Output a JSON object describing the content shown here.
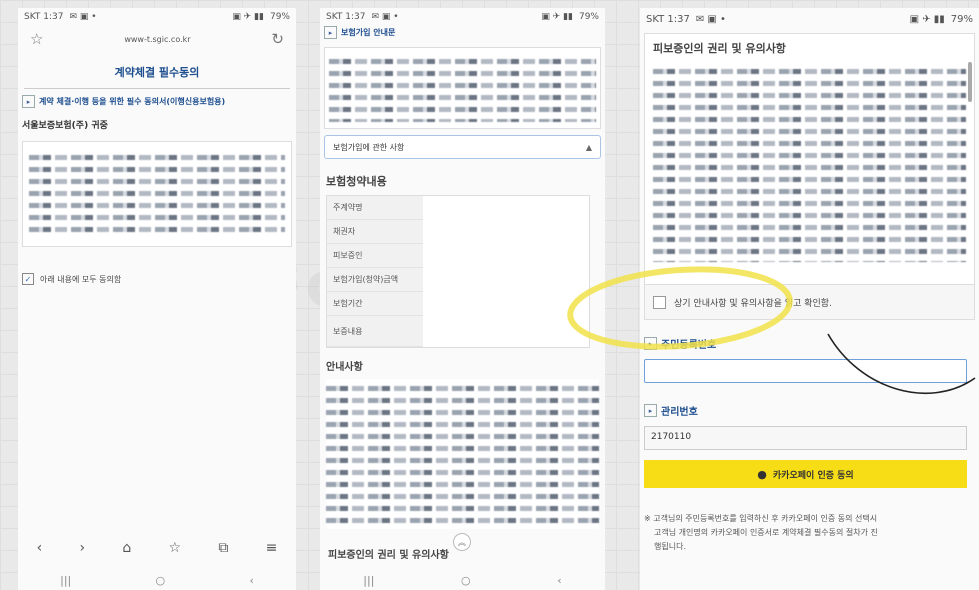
{
  "colors": {
    "accent": "#1d4e8f",
    "yellow_button": "#f7dd16",
    "highlight": "#f2e24a",
    "dark_arrow": "#222"
  },
  "watermark": "Kid Found",
  "left": {
    "status_time": "SKT 1:37",
    "status_right": "79%",
    "url": "www-t.sgic.co.kr",
    "page_title": "계약체결 필수동의",
    "section_header": "계약 체결·이행 등을 위한 필수 동의서(이행신용보험용)",
    "company": "서울보증보험(주) 귀중",
    "agree_all": "아래 내용에 모두 동의함"
  },
  "middle": {
    "status_time": "SKT 1:37",
    "status_right": "79%",
    "section_header": "보험가입 안내문",
    "dropdown_label": "보험가입에 관한 사항",
    "contract_title": "보험청약내용",
    "table_rows": [
      "주계약명",
      "채권자",
      "피보증인",
      "보험가입(청약)금액",
      "보험기간",
      "보증내용"
    ],
    "notice_title": "안내사항",
    "bottom_title": "피보증인의 권리 및 유의사항"
  },
  "right": {
    "status_time": "SKT 1:37",
    "status_right": "79%",
    "title": "피보증인의 권리 및 유의사항",
    "confirm_label": "상기 안내사항 및 유의사항을 읽고 확인함.",
    "rrn_header": "주민등록번호",
    "rrn_value": "",
    "mgmt_header": "관리번호",
    "mgmt_value": "2170110",
    "kakao_button": "카카오페이 인증 동의",
    "footnote_line1": "※ 고객님의 주민등록번호를 입력하신 후 카카오페이 인증 동의 선택시",
    "footnote_line2": "고객님 개인명의 카카오페이 인증서로 계약체결 필수동의 절차가 진",
    "footnote_line3": "행됩니다."
  }
}
